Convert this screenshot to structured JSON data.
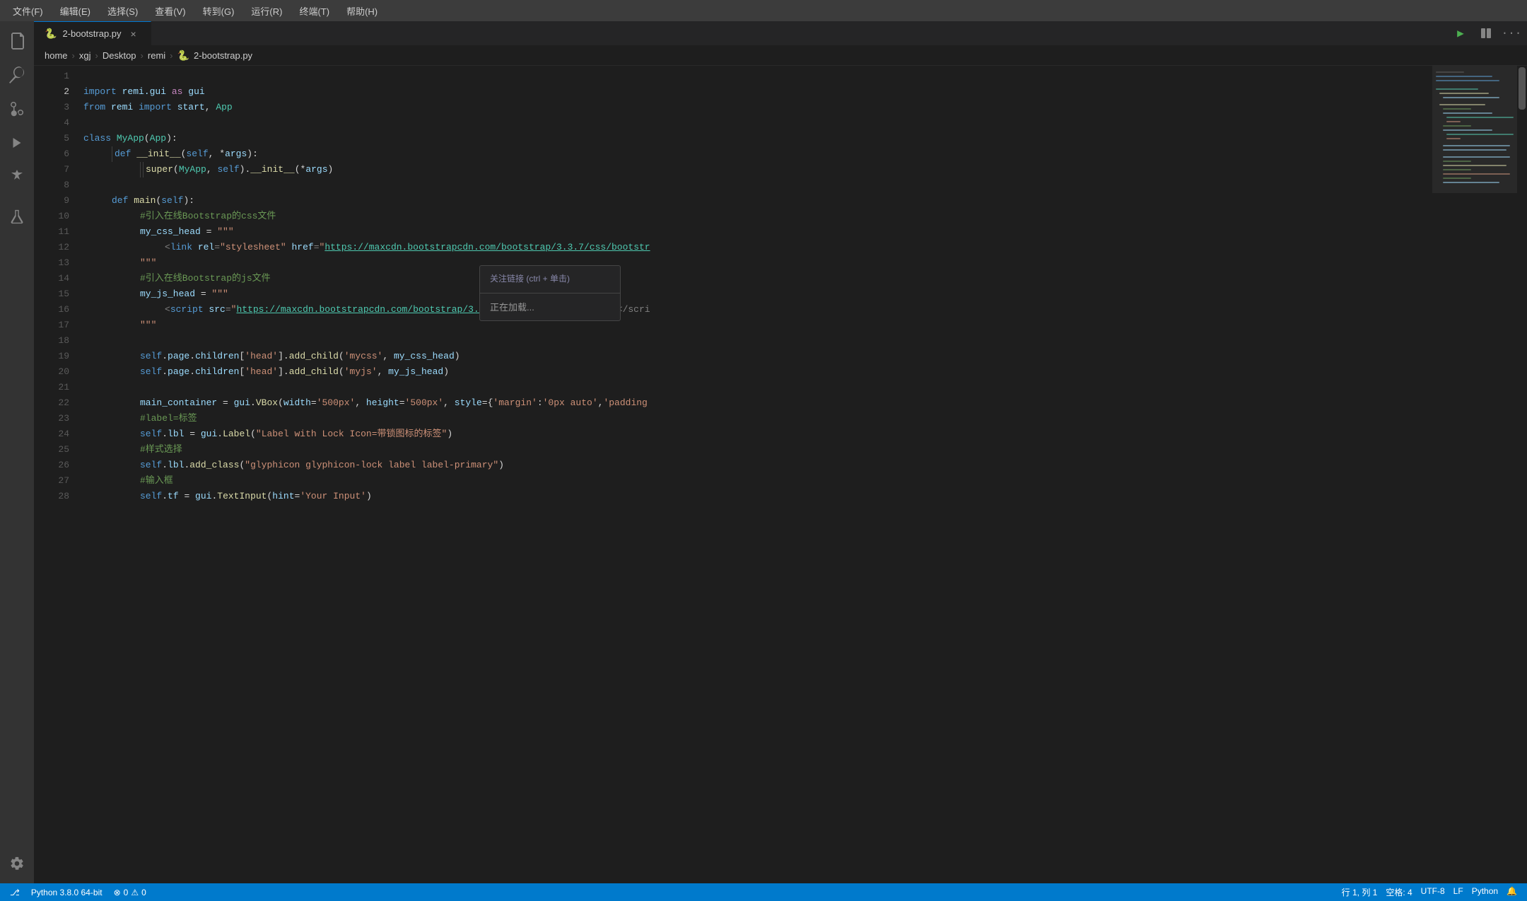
{
  "menubar": {
    "items": [
      {
        "label": "文件(F)"
      },
      {
        "label": "编辑(E)"
      },
      {
        "label": "选择(S)"
      },
      {
        "label": "查看(V)"
      },
      {
        "label": "转到(G)"
      },
      {
        "label": "运行(R)"
      },
      {
        "label": "终端(T)"
      },
      {
        "label": "帮助(H)"
      }
    ]
  },
  "activity_icons": [
    {
      "name": "explorer-icon",
      "symbol": "⎘",
      "label": "资源管理器",
      "active": false
    },
    {
      "name": "search-icon",
      "symbol": "🔍",
      "label": "搜索",
      "active": false
    },
    {
      "name": "source-control-icon",
      "symbol": "⎇",
      "label": "源代码管理",
      "active": false
    },
    {
      "name": "run-icon",
      "symbol": "▶",
      "label": "运行和调试",
      "active": false
    },
    {
      "name": "extensions-icon",
      "symbol": "⊞",
      "label": "扩展",
      "active": false
    },
    {
      "name": "flask-icon",
      "symbol": "⚗",
      "label": "测试",
      "active": false
    }
  ],
  "activity_bottom_icon": {
    "name": "settings-icon",
    "symbol": "⚙",
    "label": "设置"
  },
  "tab": {
    "icon": "🐍",
    "filename": "2-bootstrap.py",
    "close_symbol": "×",
    "active": true
  },
  "toolbar": {
    "run_symbol": "▶",
    "split_symbol": "⊟",
    "more_symbol": "⋯"
  },
  "breadcrumb": {
    "items": [
      "home",
      "xgj",
      "Desktop",
      "remi",
      "🐍 2-bootstrap.py"
    ],
    "separators": [
      ">",
      ">",
      ">",
      ">"
    ]
  },
  "code_lines": [
    {
      "num": 1,
      "content": ""
    },
    {
      "num": 2,
      "content": "    import remi.gui as gui"
    },
    {
      "num": 3,
      "content": "    from remi import start, App"
    },
    {
      "num": 4,
      "content": ""
    },
    {
      "num": 5,
      "content": "    class MyApp(App):"
    },
    {
      "num": 6,
      "content": "        def __init__(self, *args):"
    },
    {
      "num": 7,
      "content": "            super(MyApp, self).__init__(*args)"
    },
    {
      "num": 8,
      "content": ""
    },
    {
      "num": 9,
      "content": "        def main(self):"
    },
    {
      "num": 10,
      "content": "            #引入在线Bootstrap的css文件"
    },
    {
      "num": 11,
      "content": "            my_css_head = \"\"\""
    },
    {
      "num": 12,
      "content": "                <link rel=\"stylesheet\" href=\"https://maxcdn.bootstrapcdn.com/bootstrap/3.3.7/css/bootstr"
    },
    {
      "num": 13,
      "content": "            \"\"\""
    },
    {
      "num": 14,
      "content": "            #引入在线Bootstrap的js文件"
    },
    {
      "num": 15,
      "content": "            my_js_head = \"\"\""
    },
    {
      "num": 16,
      "content": "                <script src=\"https://maxcdn.bootstrapcdn.com/bootstrap/3.3.7/js/bootstrap.min.js\"></scri"
    },
    {
      "num": 17,
      "content": "            \"\"\""
    },
    {
      "num": 18,
      "content": ""
    },
    {
      "num": 19,
      "content": "            self.page.children['head'].add_child('mycss', my_css_head)"
    },
    {
      "num": 20,
      "content": "            self.page.children['head'].add_child('myjs', my_js_head)"
    },
    {
      "num": 21,
      "content": ""
    },
    {
      "num": 22,
      "content": "            main_container = gui.VBox(width='500px', height='500px', style={'margin':'0px auto','padding"
    },
    {
      "num": 23,
      "content": "            #label=标签"
    },
    {
      "num": 24,
      "content": "            self.lbl = gui.Label(\"Label with Lock Icon=带锁图标的标签\")"
    },
    {
      "num": 25,
      "content": "            #样式选择"
    },
    {
      "num": 26,
      "content": "            self.lbl.add_class(\"glyphicon glyphicon-lock label label-primary\")"
    },
    {
      "num": 27,
      "content": "            #输入框"
    },
    {
      "num": 28,
      "content": "            self.tf = gui.TextInput(hint='Your Input')"
    }
  ],
  "tooltip": {
    "item1": "关注链接 (ctrl + 单击)",
    "item2": "正在加载..."
  },
  "status_bar": {
    "git_icon": "⎇",
    "python_version": "Python 3.8.0 64-bit",
    "errors": "0",
    "warnings": "0",
    "position": "行 1, 列 1",
    "spaces": "空格: 4",
    "encoding": "UTF-8",
    "line_ending": "LF",
    "language": "Python",
    "notification_icon": "🔔"
  }
}
